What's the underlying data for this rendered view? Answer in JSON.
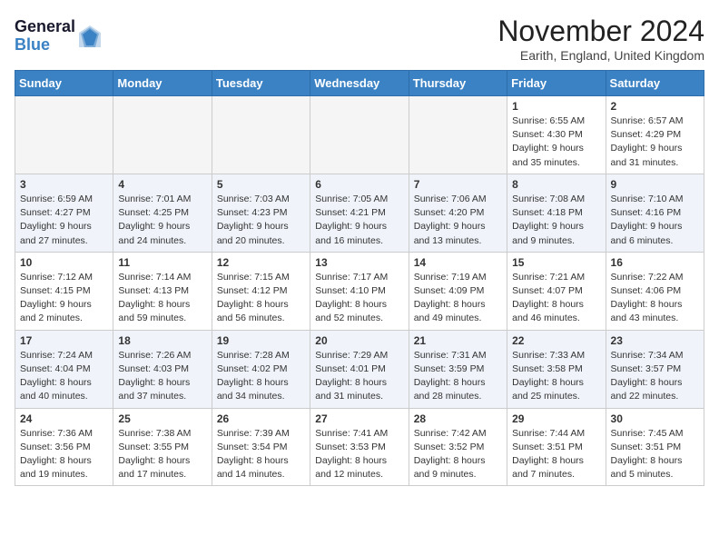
{
  "header": {
    "logo_line1": "General",
    "logo_line2": "Blue",
    "month_title": "November 2024",
    "location": "Earith, England, United Kingdom"
  },
  "days_of_week": [
    "Sunday",
    "Monday",
    "Tuesday",
    "Wednesday",
    "Thursday",
    "Friday",
    "Saturday"
  ],
  "weeks": [
    [
      {
        "day": "",
        "empty": true
      },
      {
        "day": "",
        "empty": true
      },
      {
        "day": "",
        "empty": true
      },
      {
        "day": "",
        "empty": true
      },
      {
        "day": "",
        "empty": true
      },
      {
        "day": "1",
        "sunrise": "Sunrise: 6:55 AM",
        "sunset": "Sunset: 4:30 PM",
        "daylight": "Daylight: 9 hours and 35 minutes."
      },
      {
        "day": "2",
        "sunrise": "Sunrise: 6:57 AM",
        "sunset": "Sunset: 4:29 PM",
        "daylight": "Daylight: 9 hours and 31 minutes."
      }
    ],
    [
      {
        "day": "3",
        "sunrise": "Sunrise: 6:59 AM",
        "sunset": "Sunset: 4:27 PM",
        "daylight": "Daylight: 9 hours and 27 minutes."
      },
      {
        "day": "4",
        "sunrise": "Sunrise: 7:01 AM",
        "sunset": "Sunset: 4:25 PM",
        "daylight": "Daylight: 9 hours and 24 minutes."
      },
      {
        "day": "5",
        "sunrise": "Sunrise: 7:03 AM",
        "sunset": "Sunset: 4:23 PM",
        "daylight": "Daylight: 9 hours and 20 minutes."
      },
      {
        "day": "6",
        "sunrise": "Sunrise: 7:05 AM",
        "sunset": "Sunset: 4:21 PM",
        "daylight": "Daylight: 9 hours and 16 minutes."
      },
      {
        "day": "7",
        "sunrise": "Sunrise: 7:06 AM",
        "sunset": "Sunset: 4:20 PM",
        "daylight": "Daylight: 9 hours and 13 minutes."
      },
      {
        "day": "8",
        "sunrise": "Sunrise: 7:08 AM",
        "sunset": "Sunset: 4:18 PM",
        "daylight": "Daylight: 9 hours and 9 minutes."
      },
      {
        "day": "9",
        "sunrise": "Sunrise: 7:10 AM",
        "sunset": "Sunset: 4:16 PM",
        "daylight": "Daylight: 9 hours and 6 minutes."
      }
    ],
    [
      {
        "day": "10",
        "sunrise": "Sunrise: 7:12 AM",
        "sunset": "Sunset: 4:15 PM",
        "daylight": "Daylight: 9 hours and 2 minutes."
      },
      {
        "day": "11",
        "sunrise": "Sunrise: 7:14 AM",
        "sunset": "Sunset: 4:13 PM",
        "daylight": "Daylight: 8 hours and 59 minutes."
      },
      {
        "day": "12",
        "sunrise": "Sunrise: 7:15 AM",
        "sunset": "Sunset: 4:12 PM",
        "daylight": "Daylight: 8 hours and 56 minutes."
      },
      {
        "day": "13",
        "sunrise": "Sunrise: 7:17 AM",
        "sunset": "Sunset: 4:10 PM",
        "daylight": "Daylight: 8 hours and 52 minutes."
      },
      {
        "day": "14",
        "sunrise": "Sunrise: 7:19 AM",
        "sunset": "Sunset: 4:09 PM",
        "daylight": "Daylight: 8 hours and 49 minutes."
      },
      {
        "day": "15",
        "sunrise": "Sunrise: 7:21 AM",
        "sunset": "Sunset: 4:07 PM",
        "daylight": "Daylight: 8 hours and 46 minutes."
      },
      {
        "day": "16",
        "sunrise": "Sunrise: 7:22 AM",
        "sunset": "Sunset: 4:06 PM",
        "daylight": "Daylight: 8 hours and 43 minutes."
      }
    ],
    [
      {
        "day": "17",
        "sunrise": "Sunrise: 7:24 AM",
        "sunset": "Sunset: 4:04 PM",
        "daylight": "Daylight: 8 hours and 40 minutes."
      },
      {
        "day": "18",
        "sunrise": "Sunrise: 7:26 AM",
        "sunset": "Sunset: 4:03 PM",
        "daylight": "Daylight: 8 hours and 37 minutes."
      },
      {
        "day": "19",
        "sunrise": "Sunrise: 7:28 AM",
        "sunset": "Sunset: 4:02 PM",
        "daylight": "Daylight: 8 hours and 34 minutes."
      },
      {
        "day": "20",
        "sunrise": "Sunrise: 7:29 AM",
        "sunset": "Sunset: 4:01 PM",
        "daylight": "Daylight: 8 hours and 31 minutes."
      },
      {
        "day": "21",
        "sunrise": "Sunrise: 7:31 AM",
        "sunset": "Sunset: 3:59 PM",
        "daylight": "Daylight: 8 hours and 28 minutes."
      },
      {
        "day": "22",
        "sunrise": "Sunrise: 7:33 AM",
        "sunset": "Sunset: 3:58 PM",
        "daylight": "Daylight: 8 hours and 25 minutes."
      },
      {
        "day": "23",
        "sunrise": "Sunrise: 7:34 AM",
        "sunset": "Sunset: 3:57 PM",
        "daylight": "Daylight: 8 hours and 22 minutes."
      }
    ],
    [
      {
        "day": "24",
        "sunrise": "Sunrise: 7:36 AM",
        "sunset": "Sunset: 3:56 PM",
        "daylight": "Daylight: 8 hours and 19 minutes."
      },
      {
        "day": "25",
        "sunrise": "Sunrise: 7:38 AM",
        "sunset": "Sunset: 3:55 PM",
        "daylight": "Daylight: 8 hours and 17 minutes."
      },
      {
        "day": "26",
        "sunrise": "Sunrise: 7:39 AM",
        "sunset": "Sunset: 3:54 PM",
        "daylight": "Daylight: 8 hours and 14 minutes."
      },
      {
        "day": "27",
        "sunrise": "Sunrise: 7:41 AM",
        "sunset": "Sunset: 3:53 PM",
        "daylight": "Daylight: 8 hours and 12 minutes."
      },
      {
        "day": "28",
        "sunrise": "Sunrise: 7:42 AM",
        "sunset": "Sunset: 3:52 PM",
        "daylight": "Daylight: 8 hours and 9 minutes."
      },
      {
        "day": "29",
        "sunrise": "Sunrise: 7:44 AM",
        "sunset": "Sunset: 3:51 PM",
        "daylight": "Daylight: 8 hours and 7 minutes."
      },
      {
        "day": "30",
        "sunrise": "Sunrise: 7:45 AM",
        "sunset": "Sunset: 3:51 PM",
        "daylight": "Daylight: 8 hours and 5 minutes."
      }
    ]
  ]
}
